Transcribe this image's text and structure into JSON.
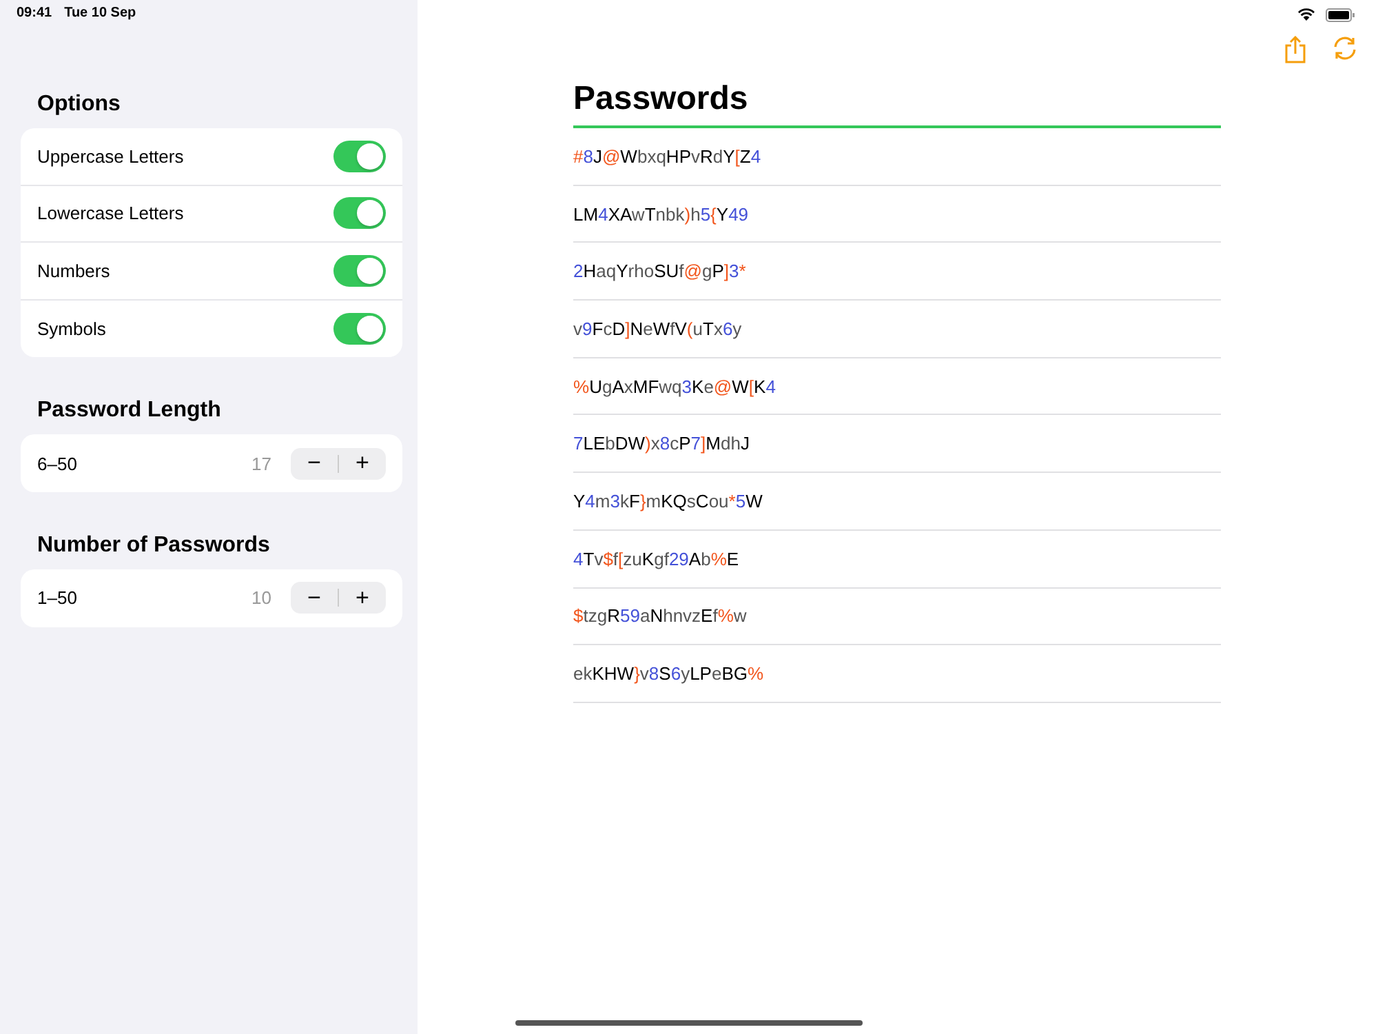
{
  "status_bar": {
    "time": "09:41",
    "date": "Tue 10 Sep"
  },
  "options": {
    "title": "Options",
    "items": [
      {
        "label": "Uppercase Letters",
        "on": true
      },
      {
        "label": "Lowercase Letters",
        "on": true
      },
      {
        "label": "Numbers",
        "on": true
      },
      {
        "label": "Symbols",
        "on": true
      }
    ]
  },
  "steppers": [
    {
      "title": "Password Length",
      "range": "6–50",
      "value": "17",
      "minus": "−",
      "plus": "+"
    },
    {
      "title": "Number of Passwords",
      "range": "1–50",
      "value": "10",
      "minus": "−",
      "plus": "+"
    }
  ],
  "main": {
    "title": "Passwords",
    "passwords": [
      "#8J@WbxqHPvRdY[Z4",
      "LM4XAwTnbk)h5{Y49",
      "2HaqYrhoSUf@gP]3*",
      "v9FcD]NeWfV(uTx6y",
      "%UgAxMFwq3Ke@W[K4",
      "7LEbDW)x8cP7]MdhJ",
      "Y4m3kF}mKQsCou*5W",
      "4Tv$f[zuKgf29Ab%E",
      "$tzgR59aNhnvzEf%w",
      "ekKHW}v8S6yLPeBG%"
    ]
  }
}
